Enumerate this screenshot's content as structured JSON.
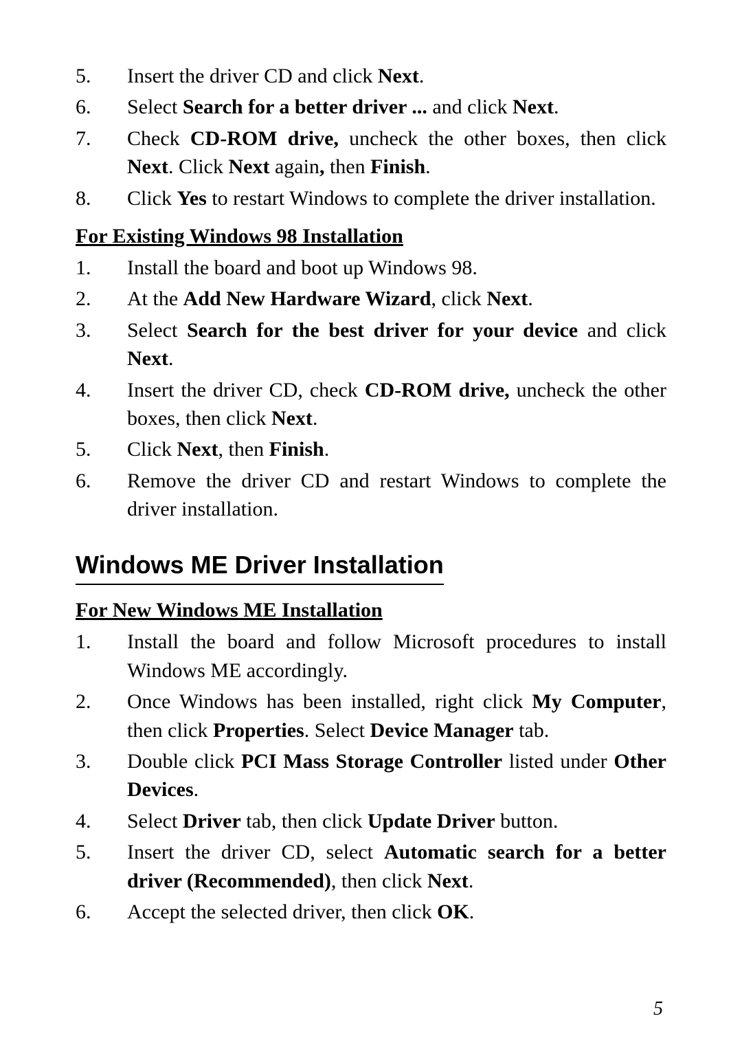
{
  "top_list": [
    {
      "n": "5.",
      "segs": [
        {
          "t": "Insert the driver CD and click "
        },
        {
          "t": "Next",
          "b": true
        },
        {
          "t": "."
        }
      ]
    },
    {
      "n": "6.",
      "segs": [
        {
          "t": "Select "
        },
        {
          "t": "Search for a better driver ...",
          "b": true
        },
        {
          "t": " and click "
        },
        {
          "t": "Next",
          "b": true
        },
        {
          "t": "."
        }
      ]
    },
    {
      "n": "7.",
      "segs": [
        {
          "t": "Check "
        },
        {
          "t": "CD-ROM drive,",
          "b": true
        },
        {
          "t": " uncheck the other boxes, then click "
        },
        {
          "t": "Next",
          "b": true
        },
        {
          "t": ".  Click "
        },
        {
          "t": "Next",
          "b": true
        },
        {
          "t": " again"
        },
        {
          "t": ",",
          "b": true
        },
        {
          "t": " then "
        },
        {
          "t": "Finish",
          "b": true
        },
        {
          "t": "."
        }
      ]
    },
    {
      "n": "8.",
      "segs": [
        {
          "t": "Click "
        },
        {
          "t": "Yes",
          "b": true
        },
        {
          "t": " to restart Windows to complete the driver installation."
        }
      ]
    }
  ],
  "sub1_title": "For Existing Windows 98 Installation",
  "sub1_list": [
    {
      "n": "1.",
      "segs": [
        {
          "t": "Install the board and boot up Windows 98."
        }
      ]
    },
    {
      "n": "2.",
      "segs": [
        {
          "t": "At the "
        },
        {
          "t": "Add New Hardware Wizard",
          "b": true
        },
        {
          "t": ", click "
        },
        {
          "t": "Next",
          "b": true
        },
        {
          "t": "."
        }
      ]
    },
    {
      "n": "3.",
      "segs": [
        {
          "t": "Select "
        },
        {
          "t": "Search for the best driver for your device",
          "b": true
        },
        {
          "t": " and click "
        },
        {
          "t": "Next",
          "b": true
        },
        {
          "t": "."
        }
      ]
    },
    {
      "n": "4.",
      "segs": [
        {
          "t": "Insert the driver CD, check "
        },
        {
          "t": "CD-ROM drive,",
          "b": true
        },
        {
          "t": " uncheck the other boxes, then click "
        },
        {
          "t": "Next",
          "b": true
        },
        {
          "t": "."
        }
      ]
    },
    {
      "n": "5.",
      "segs": [
        {
          "t": "Click "
        },
        {
          "t": "Next",
          "b": true
        },
        {
          "t": ", then "
        },
        {
          "t": "Finish",
          "b": true
        },
        {
          "t": "."
        }
      ]
    },
    {
      "n": "6.",
      "segs": [
        {
          "t": "Remove the driver CD and restart Windows to complete the driver installation."
        }
      ]
    }
  ],
  "heading": "Windows ME Driver Installation",
  "sub2_title": "For New Windows ME Installation",
  "sub2_list": [
    {
      "n": "1.",
      "segs": [
        {
          "t": "Install the board and follow Microsoft procedures to install Windows ME accordingly."
        }
      ]
    },
    {
      "n": "2.",
      "segs": [
        {
          "t": "Once Windows has been installed, right click "
        },
        {
          "t": "My Computer",
          "b": true
        },
        {
          "t": ", then click "
        },
        {
          "t": "Properties",
          "b": true
        },
        {
          "t": ".  Select "
        },
        {
          "t": "Device Manager",
          "b": true
        },
        {
          "t": " tab."
        }
      ]
    },
    {
      "n": "3.",
      "segs": [
        {
          "t": "Double click "
        },
        {
          "t": "PCI Mass Storage Controller",
          "b": true
        },
        {
          "t": " listed under "
        },
        {
          "t": "Other Devices",
          "b": true
        },
        {
          "t": "."
        }
      ]
    },
    {
      "n": "4.",
      "segs": [
        {
          "t": "Select "
        },
        {
          "t": "Driver",
          "b": true
        },
        {
          "t": " tab, then click "
        },
        {
          "t": "Update Driver",
          "b": true
        },
        {
          "t": " button."
        }
      ]
    },
    {
      "n": "5.",
      "segs": [
        {
          "t": "Insert the driver CD, select "
        },
        {
          "t": "Automatic search for a better driver (Recommended)",
          "b": true
        },
        {
          "t": ", then click "
        },
        {
          "t": "Next",
          "b": true
        },
        {
          "t": "."
        }
      ]
    },
    {
      "n": "6.",
      "segs": [
        {
          "t": "Accept the selected driver, then click "
        },
        {
          "t": "OK",
          "b": true
        },
        {
          "t": "."
        }
      ]
    }
  ],
  "page_number": "5"
}
